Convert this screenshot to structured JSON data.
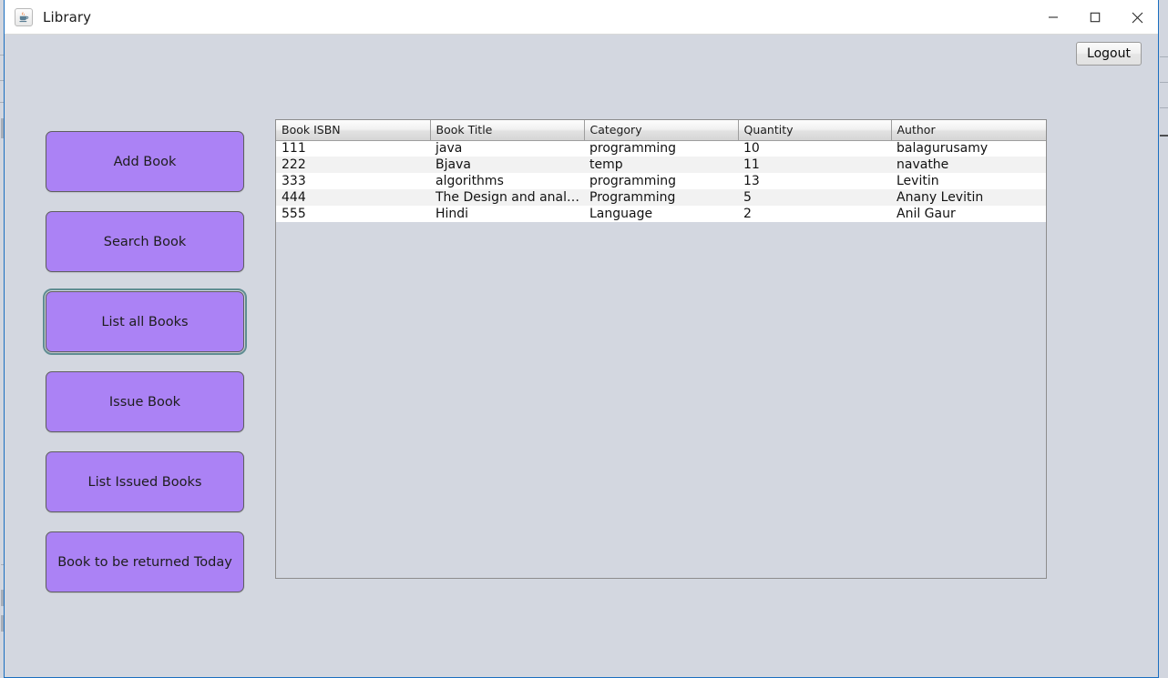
{
  "window": {
    "title": "Library",
    "app_icon": "java-coffee-cup-icon",
    "controls": {
      "minimize": "minimize-icon",
      "maximize": "maximize-icon",
      "close": "close-icon"
    }
  },
  "toolbar": {
    "logout_label": "Logout"
  },
  "sidebar": {
    "buttons": [
      {
        "label": "Add Book",
        "focused": false
      },
      {
        "label": "Search Book",
        "focused": false
      },
      {
        "label": "List all Books",
        "focused": true
      },
      {
        "label": "Issue Book",
        "focused": false
      },
      {
        "label": "List Issued Books",
        "focused": false
      },
      {
        "label": "Book to be returned Today",
        "focused": false
      }
    ]
  },
  "table": {
    "columns": [
      "Book ISBN",
      "Book Title",
      "Category",
      "Quantity",
      "Author"
    ],
    "rows": [
      [
        "111",
        "java",
        "programming",
        "10",
        "balagurusamy"
      ],
      [
        "222",
        "Bjava",
        "temp",
        "11",
        "navathe"
      ],
      [
        "333",
        "algorithms",
        "programming",
        "13",
        "Levitin"
      ],
      [
        "444",
        "The Design and analysis...",
        "Programming",
        "5",
        "Anany Levitin"
      ],
      [
        "555",
        "Hindi",
        "Language",
        "2",
        "Anil Gaur"
      ]
    ]
  },
  "colors": {
    "button_purple": "#ab82f5",
    "window_background": "#d3d7e0",
    "focus_ring": "#5f8d92",
    "titlebar": "#ffffff",
    "window_border": "#1a6ec0",
    "row_stripe": "#f2f2f2"
  }
}
